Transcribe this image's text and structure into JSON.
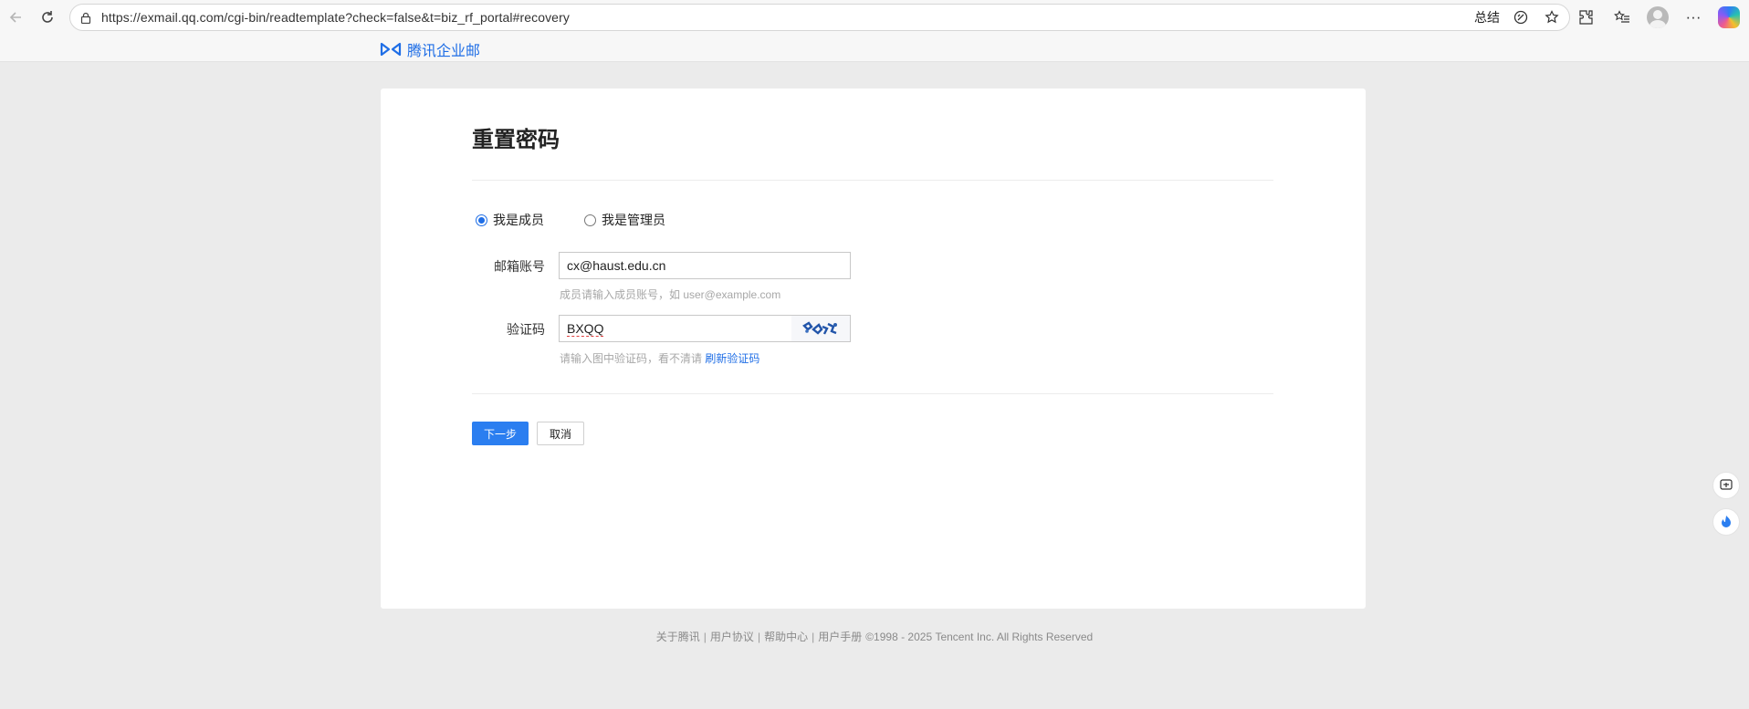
{
  "browser": {
    "url": "https://exmail.qq.com/cgi-bin/readtemplate?check=false&t=biz_rf_portal#recovery",
    "summary_label": "总结",
    "icons": [
      "back-icon",
      "refresh-icon",
      "lock-icon",
      "reading-icon",
      "star-icon",
      "extensions-icon",
      "favorites-icon",
      "profile-avatar",
      "more-icon",
      "copilot-icon"
    ]
  },
  "header": {
    "brand": "腾讯企业邮"
  },
  "page": {
    "title": "重置密码",
    "radio_member": "我是成员",
    "radio_admin": "我是管理员",
    "selected_role": "member",
    "email_label": "邮箱账号",
    "email_value": "cx@haust.edu.cn",
    "email_hint": "成员请输入成员账号，如 user@example.com",
    "captcha_label": "验证码",
    "captcha_value": "BXQQ",
    "captcha_hint": "请输入图中验证码，看不清请",
    "captcha_refresh": "刷新验证码",
    "next_button": "下一步",
    "cancel_button": "取消"
  },
  "footer": {
    "links": [
      "关于腾讯",
      "用户协议",
      "帮助中心",
      "用户手册"
    ],
    "separator": "|",
    "copyright": "©1998 - 2025 Tencent Inc. All Rights Reserved"
  },
  "colors": {
    "accent": "#2b7ef0",
    "brand": "#1f6ee6",
    "page_bg": "#ebebeb"
  }
}
